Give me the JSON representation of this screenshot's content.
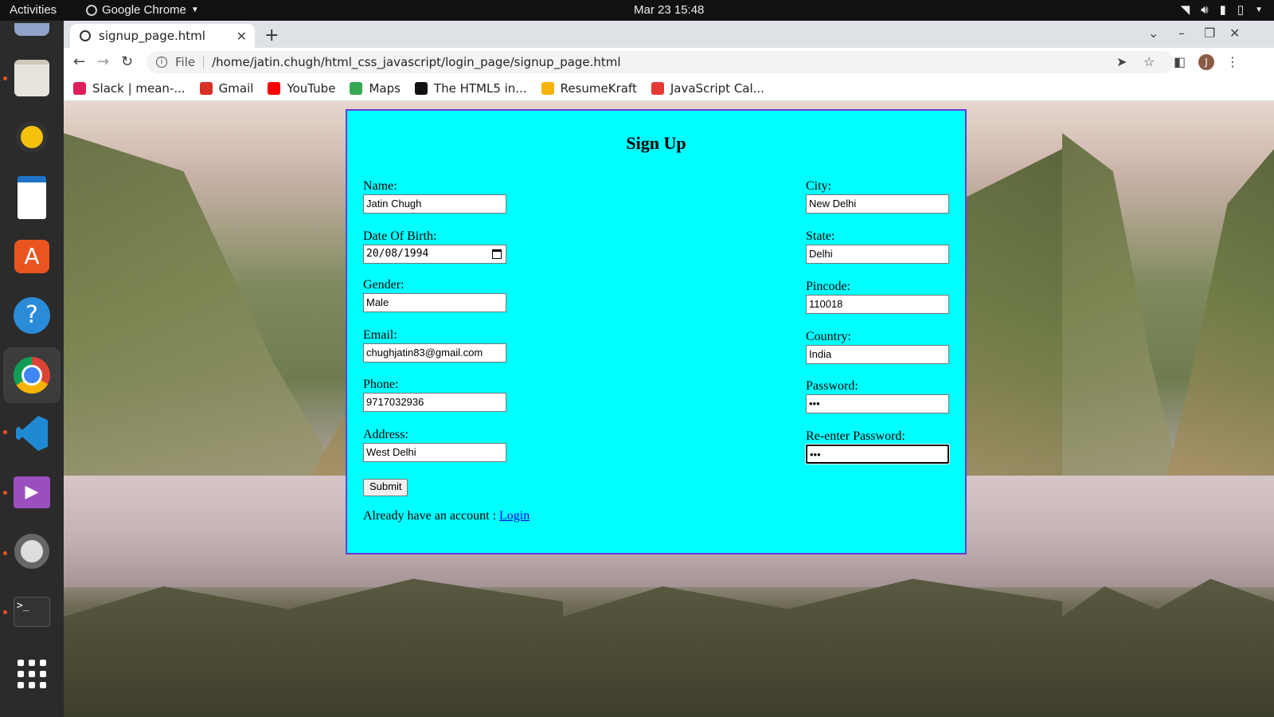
{
  "topbar": {
    "activities": "Activities",
    "app_name": "Google Chrome",
    "clock": "Mar 23  15:48"
  },
  "dock": {
    "items": [
      "files-icon",
      "rhythmbox-icon",
      "writer-icon",
      "software-icon",
      "help-icon",
      "chrome-icon",
      "vscode-icon",
      "videos-icon",
      "settings-icon",
      "terminal-icon",
      "app-grid-icon"
    ]
  },
  "browser": {
    "tab_title": "signup_page.html",
    "scheme_label": "File",
    "url": "/home/jatin.chugh/html_css_javascript/login_page/signup_page.html",
    "profile_initial": "J",
    "bookmarks": [
      {
        "label": "Slack | mean-...",
        "color": "#e01e5a"
      },
      {
        "label": "Gmail",
        "color": "#d93025"
      },
      {
        "label": "YouTube",
        "color": "#ff0000"
      },
      {
        "label": "Maps",
        "color": "#34a853"
      },
      {
        "label": "The HTML5 in...",
        "color": "#111111"
      },
      {
        "label": "ResumeKraft",
        "color": "#f4b400"
      },
      {
        "label": "JavaScript Cal...",
        "color": "#e53935"
      }
    ]
  },
  "form": {
    "title": "Sign Up",
    "left": [
      {
        "label": "Name:",
        "value": "Jatin Chugh"
      },
      {
        "label": "Date Of Birth:",
        "value": "20/08/1994"
      },
      {
        "label": "Gender:",
        "value": "Male"
      },
      {
        "label": "Email:",
        "value": "chughjatin83@gmail.com"
      },
      {
        "label": "Phone:",
        "value": "9717032936"
      },
      {
        "label": "Address:",
        "value": "West Delhi"
      }
    ],
    "right": [
      {
        "label": "City:",
        "value": "New Delhi"
      },
      {
        "label": "State:",
        "value": "Delhi"
      },
      {
        "label": "Pincode:",
        "value": "110018"
      },
      {
        "label": "Country:",
        "value": "India"
      },
      {
        "label": "Password:",
        "value": "•••"
      },
      {
        "label": "Re-enter Password:",
        "value": "•••"
      }
    ],
    "submit_label": "Submit",
    "already_text": "Already have an account :",
    "login_link": "Login",
    "card_color": "#00ffff",
    "border_color": "#6a3bd8"
  }
}
